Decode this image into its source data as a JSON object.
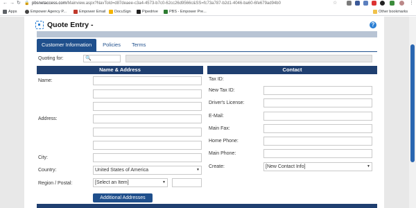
{
  "browser": {
    "url_host": "pbsnetaccess.com",
    "url_path": "/Mainview.aspx?NavToId=d87deaee-c3a4-4573-b7c0-62cc26d9566c&SS=fc73a787-b2d1-4046-ba60-6fe679ad94b0"
  },
  "bookmarks": {
    "items": [
      {
        "label": "Apps",
        "icon": "apps-grid-icon",
        "color": "#5f6368"
      },
      {
        "label": "Empower Agency P...",
        "icon": "empower-logo-icon",
        "color": "#444444"
      },
      {
        "label": "Empower Email",
        "icon": "email-icon",
        "color": "#c0392b"
      },
      {
        "label": "DocuSign",
        "icon": "docusign-icon",
        "color": "#f5b400"
      },
      {
        "label": "Pipedrive",
        "icon": "pipedrive-icon",
        "color": "#222222"
      },
      {
        "label": "PBS - Empower Pre...",
        "icon": "pbs-icon",
        "color": "#2e7d32"
      }
    ],
    "other": "Other bookmarks"
  },
  "header": {
    "title": "Quote Entry -",
    "help": "?"
  },
  "tabs": [
    {
      "label": "Customer Information",
      "active": true
    },
    {
      "label": "Policies",
      "active": false
    },
    {
      "label": "Terms",
      "active": false
    }
  ],
  "quoting": {
    "label": "Quoting for:",
    "search_icon": "search-icon"
  },
  "sections": {
    "name_address": "Name & Address",
    "contact": "Contact"
  },
  "left_fields": {
    "name": "Name:",
    "address": "Address:",
    "city": "City:",
    "country": "Country:",
    "country_value": "United States of America",
    "region": "Region / Postal:",
    "region_value": "[Select an Item]"
  },
  "right_fields": {
    "tax_id": "Tax ID:",
    "new_tax_id": "New Tax ID:",
    "drivers_license": "Driver's License:",
    "email": "E-Mail:",
    "main_fax": "Main Fax:",
    "home_phone": "Home Phone:",
    "main_phone": "Main Phone:",
    "create": "Create:",
    "create_value": "[New Contact Info]"
  },
  "buttons": {
    "additional_addresses": "Additional Addresses"
  }
}
